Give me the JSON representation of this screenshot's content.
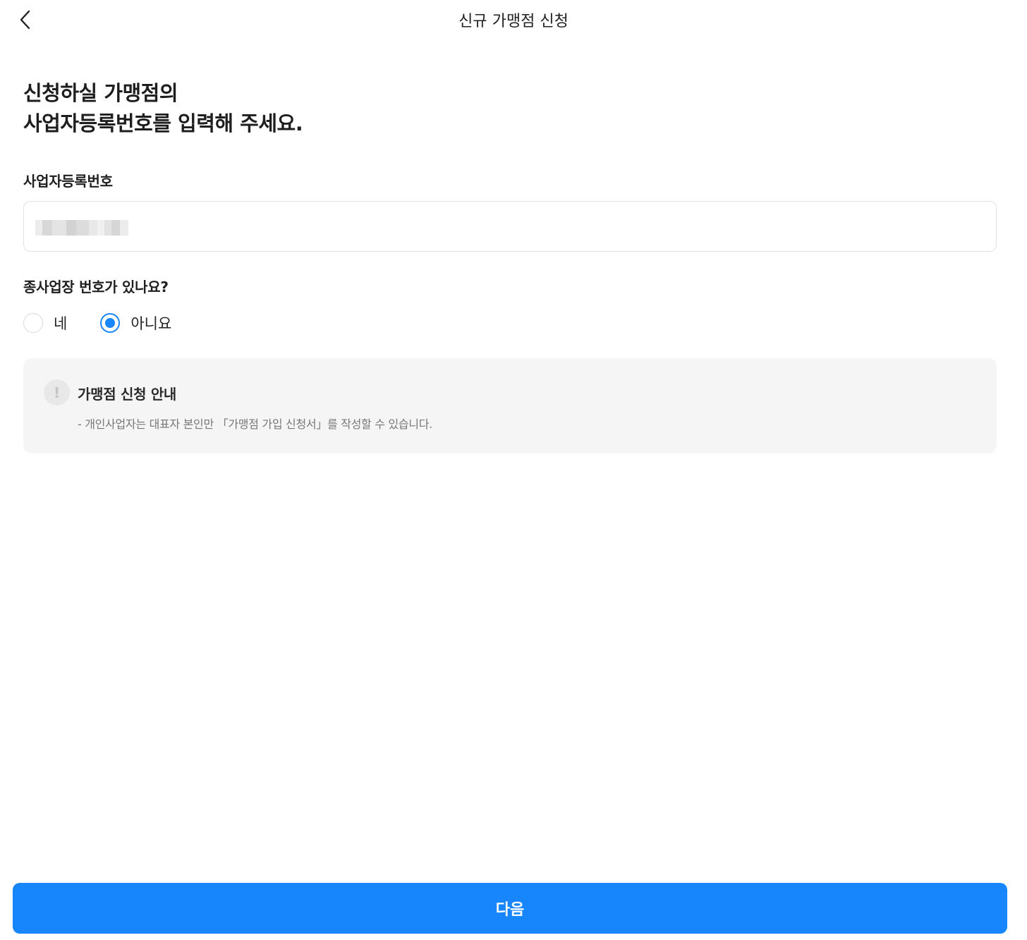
{
  "header": {
    "back_icon": "chevron-left-icon",
    "title": "신규 가맹점 신청"
  },
  "heading": {
    "line1": "신청하실 가맹점의",
    "line2": "사업자등록번호를 입력해 주세요."
  },
  "business_number": {
    "label": "사업자등록번호",
    "value_masked": true
  },
  "branch_question": {
    "label": "종사업장 번호가 있나요?",
    "options": [
      {
        "label": "네",
        "checked": false
      },
      {
        "label": "아니요",
        "checked": true
      }
    ]
  },
  "notice": {
    "icon": "exclamation-icon",
    "icon_glyph": "!",
    "title": "가맹점 신청 안내",
    "text": "- 개인사업자는 대표자 본인만 「가맹점 가입 신청서」를 작성할 수 있습니다."
  },
  "footer": {
    "next_label": "다음"
  },
  "colors": {
    "accent": "#1786fc",
    "notice_bg": "#f5f5f5"
  }
}
